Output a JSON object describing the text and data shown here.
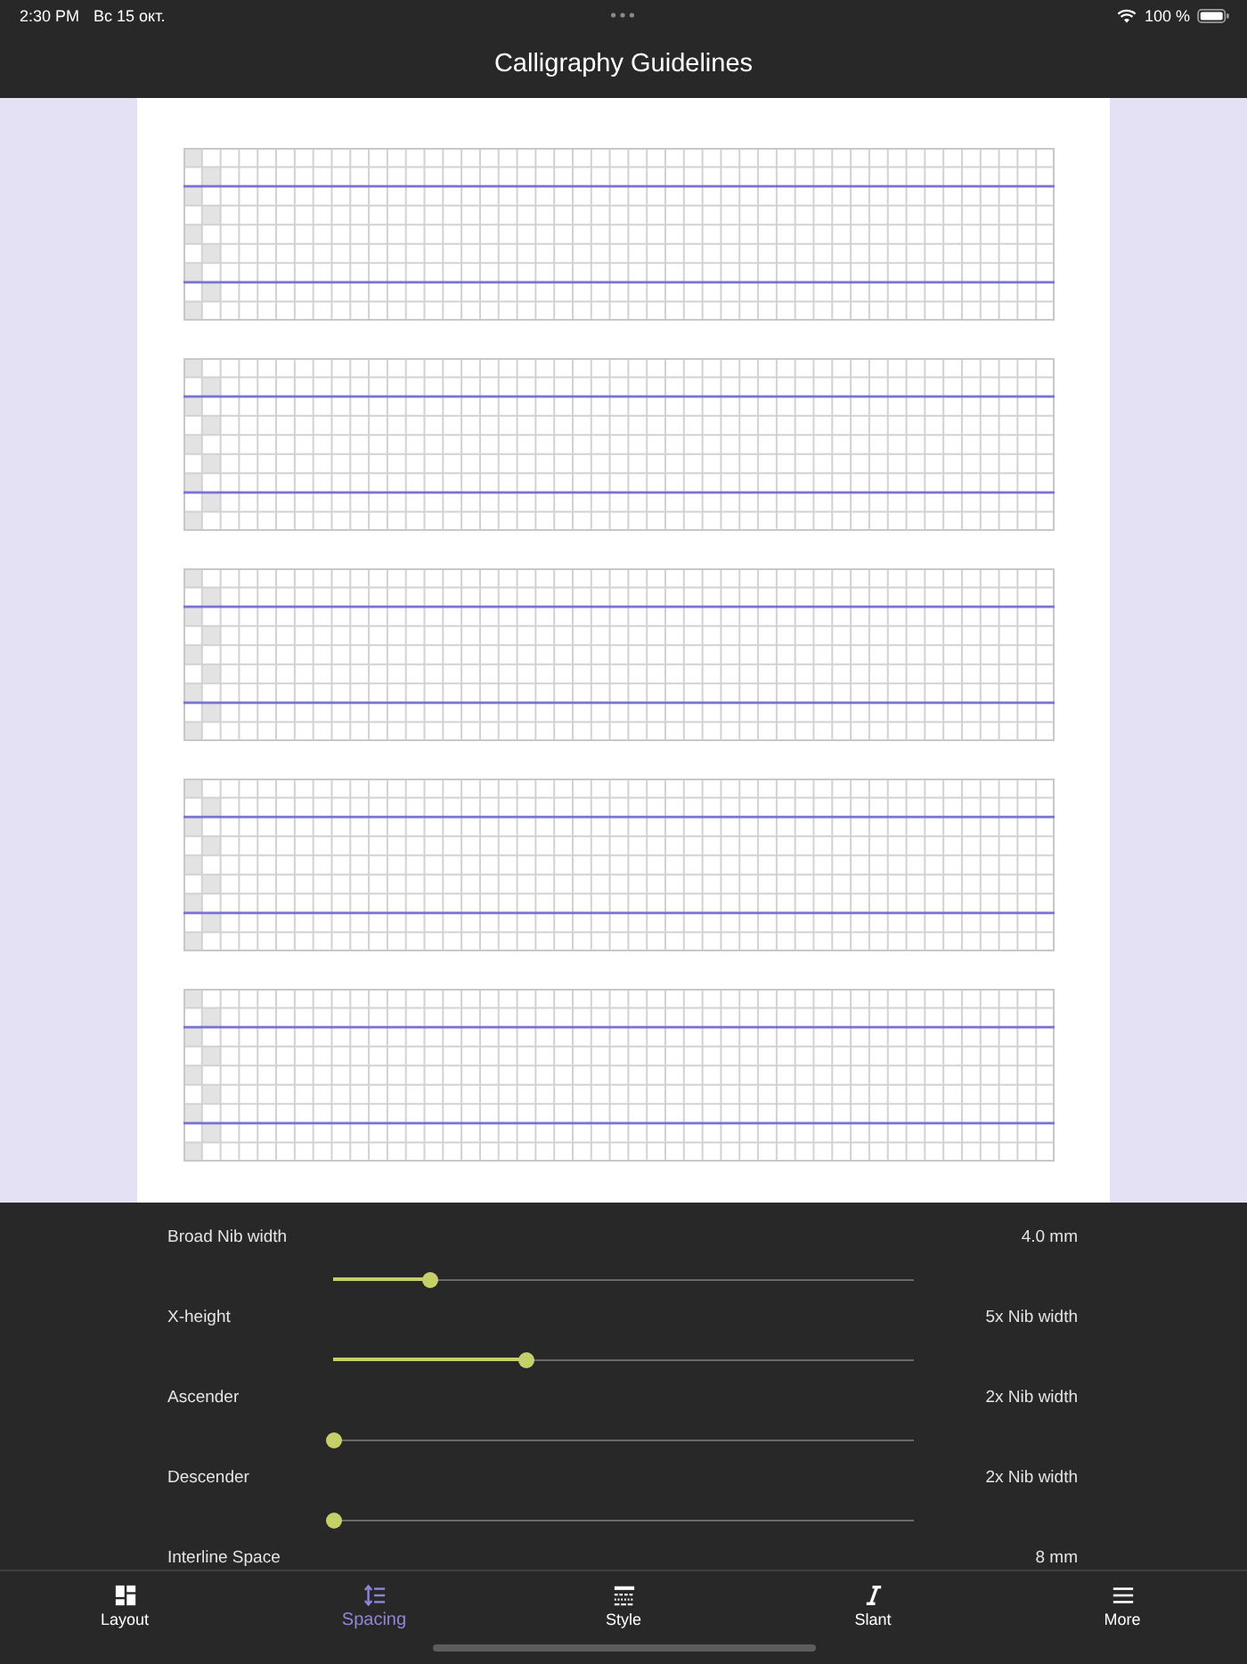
{
  "status_bar": {
    "time": "2:30 PM",
    "date": "Вс 15 окт.",
    "battery": "100 %"
  },
  "nav_bar": {
    "title": "Calligraphy Guidelines"
  },
  "settings": [
    {
      "label": "Broad Nib width",
      "value": "4.0 mm",
      "level": 0.166
    },
    {
      "label": "X-height",
      "value": "5x Nib width",
      "level": 0.334
    },
    {
      "label": "Ascender",
      "value": "2x Nib width",
      "level": 0
    },
    {
      "label": "Descender",
      "value": "2x Nib width",
      "level": 0
    },
    {
      "label": "Interline Space",
      "value": "8 mm"
    }
  ],
  "tabs": [
    {
      "label": "Layout",
      "selected": false
    },
    {
      "label": "Spacing",
      "selected": true
    },
    {
      "label": "Style",
      "selected": false
    },
    {
      "label": "Slant",
      "selected": false
    },
    {
      "label": "More",
      "selected": false
    }
  ]
}
